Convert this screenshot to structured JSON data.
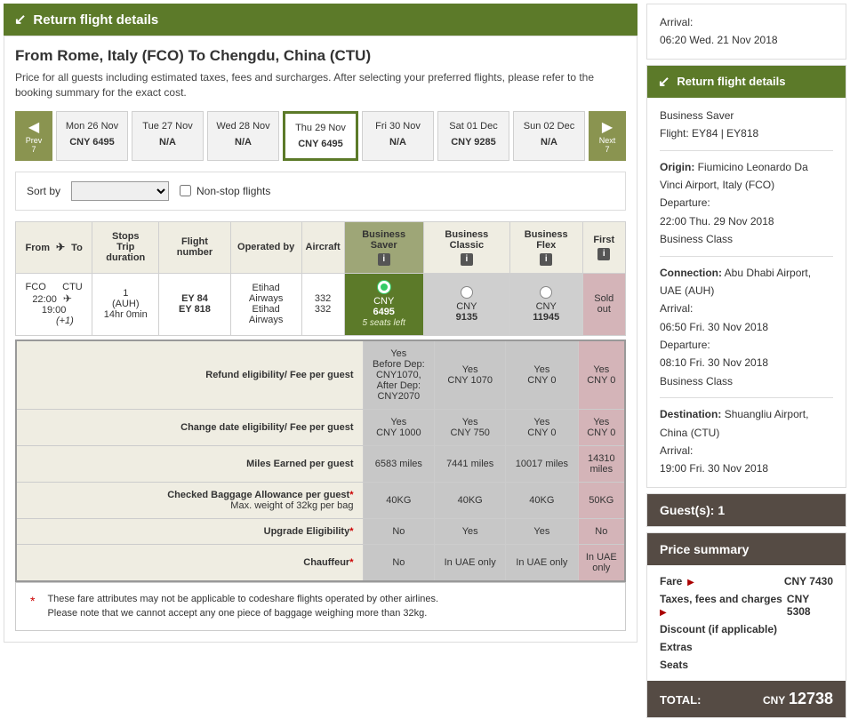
{
  "header": {
    "title": "Return flight details"
  },
  "route": {
    "title": "From Rome, Italy (FCO) To Chengdu, China (CTU)",
    "desc": "Price for all guests including estimated taxes, fees and surcharges. After selecting your preferred flights, please refer to the booking summary for the exact cost."
  },
  "dateNav": {
    "prev": {
      "label": "Prev",
      "days": "7"
    },
    "next": {
      "label": "Next",
      "days": "7"
    },
    "items": [
      {
        "date": "Mon 26 Nov",
        "price": "CNY 6495"
      },
      {
        "date": "Tue 27 Nov",
        "price": "N/A"
      },
      {
        "date": "Wed 28 Nov",
        "price": "N/A"
      },
      {
        "date": "Thu 29 Nov",
        "price": "CNY 6495"
      },
      {
        "date": "Fri 30 Nov",
        "price": "N/A"
      },
      {
        "date": "Sat 01 Dec",
        "price": "CNY 9285"
      },
      {
        "date": "Sun 02 Dec",
        "price": "N/A"
      }
    ]
  },
  "sort": {
    "label": "Sort by",
    "nonstop": "Non-stop flights"
  },
  "table": {
    "head": {
      "from": "From",
      "to": "To",
      "stops": "Stops",
      "dur": "Trip duration",
      "flight": "Flight number",
      "op": "Operated by",
      "ac": "Aircraft",
      "saver": "Business Saver",
      "classic": "Business Classic",
      "flex": "Business Flex",
      "first": "First"
    },
    "row": {
      "fromCode": "FCO",
      "fromTime": "22:00",
      "toCode": "CTU",
      "toTime": "19:00",
      "toPlus": "(+1)",
      "stops": "1",
      "stopVia": "(AUH)",
      "dur": "14hr 0min",
      "f1": "EY 84",
      "f2": "EY 818",
      "op1": "Etihad Airways",
      "op2": "Etihad Airways",
      "ac1": "332",
      "ac2": "332",
      "saverCur": "CNY",
      "saverAmt": "6495",
      "saverSeats": "5 seats left",
      "classicCur": "CNY",
      "classicAmt": "9135",
      "flexCur": "CNY",
      "flexAmt": "11945",
      "first": "Sold out"
    }
  },
  "attrs": {
    "refund": {
      "label": "Refund eligibility/ Fee per guest",
      "v1": "Yes\nBefore Dep:\nCNY1070,\nAfter Dep:\nCNY2070",
      "v2": "Yes\nCNY 1070",
      "v3": "Yes\nCNY 0",
      "v4": "Yes\nCNY 0"
    },
    "change": {
      "label": "Change date eligibility/ Fee per guest",
      "v1": "Yes\nCNY 1000",
      "v2": "Yes\nCNY 750",
      "v3": "Yes\nCNY 0",
      "v4": "Yes\nCNY 0"
    },
    "miles": {
      "label": "Miles Earned per guest",
      "v1": "6583 miles",
      "v2": "7441 miles",
      "v3": "10017 miles",
      "v4": "14310\nmiles"
    },
    "baggage": {
      "label": "Checked Baggage Allowance per guest",
      "sub": "Max. weight of 32kg per bag",
      "v1": "40KG",
      "v2": "40KG",
      "v3": "40KG",
      "v4": "50KG"
    },
    "upgrade": {
      "label": "Upgrade Eligibility",
      "v1": "No",
      "v2": "Yes",
      "v3": "Yes",
      "v4": "No"
    },
    "chauf": {
      "label": "Chauffeur",
      "v1": "No",
      "v2": "In UAE only",
      "v3": "In UAE only",
      "v4": "In UAE\nonly"
    }
  },
  "footnote": "These fare attributes may not be applicable to codeshare flights operated by other airlines.\nPlease note that we cannot accept any one piece of baggage weighing more than 32kg.",
  "side": {
    "arrival": {
      "label": "Arrival:",
      "val": "06:20 Wed. 21 Nov 2018"
    },
    "retHead": "Return flight details",
    "cls": "Business Saver",
    "flt": "Flight: EY84 | EY818",
    "origLabel": "Origin:",
    "origVal": "Fiumicino Leonardo Da Vinci Airport, Italy (FCO)",
    "depLabel": "Departure:",
    "depVal": "22:00 Thu. 29 Nov 2018",
    "depCls": "Business Class",
    "conLabel": "Connection:",
    "conVal": "Abu Dhabi Airport, UAE (AUH)",
    "arrLabel": "Arrival:",
    "arrVal": "06:50 Fri. 30 Nov 2018",
    "dep2Label": "Departure:",
    "dep2Val": "08:10 Fri. 30 Nov 2018",
    "dep2Cls": "Business Class",
    "destLabel": "Destination:",
    "destVal": "Shuangliu Airport, China (CTU)",
    "arr2Label": "Arrival:",
    "arr2Val": "19:00 Fri. 30 Nov 2018",
    "guests": "Guest(s): 1",
    "priceHead": "Price summary",
    "fare": {
      "label": "Fare",
      "val": "CNY 7430"
    },
    "tax": {
      "label": "Taxes, fees and charges",
      "val": "CNY 5308"
    },
    "disc": "Discount (if applicable)",
    "extras": "Extras",
    "seats": "Seats",
    "total": {
      "label": "TOTAL:",
      "cur": "CNY",
      "amt": "12738"
    }
  }
}
